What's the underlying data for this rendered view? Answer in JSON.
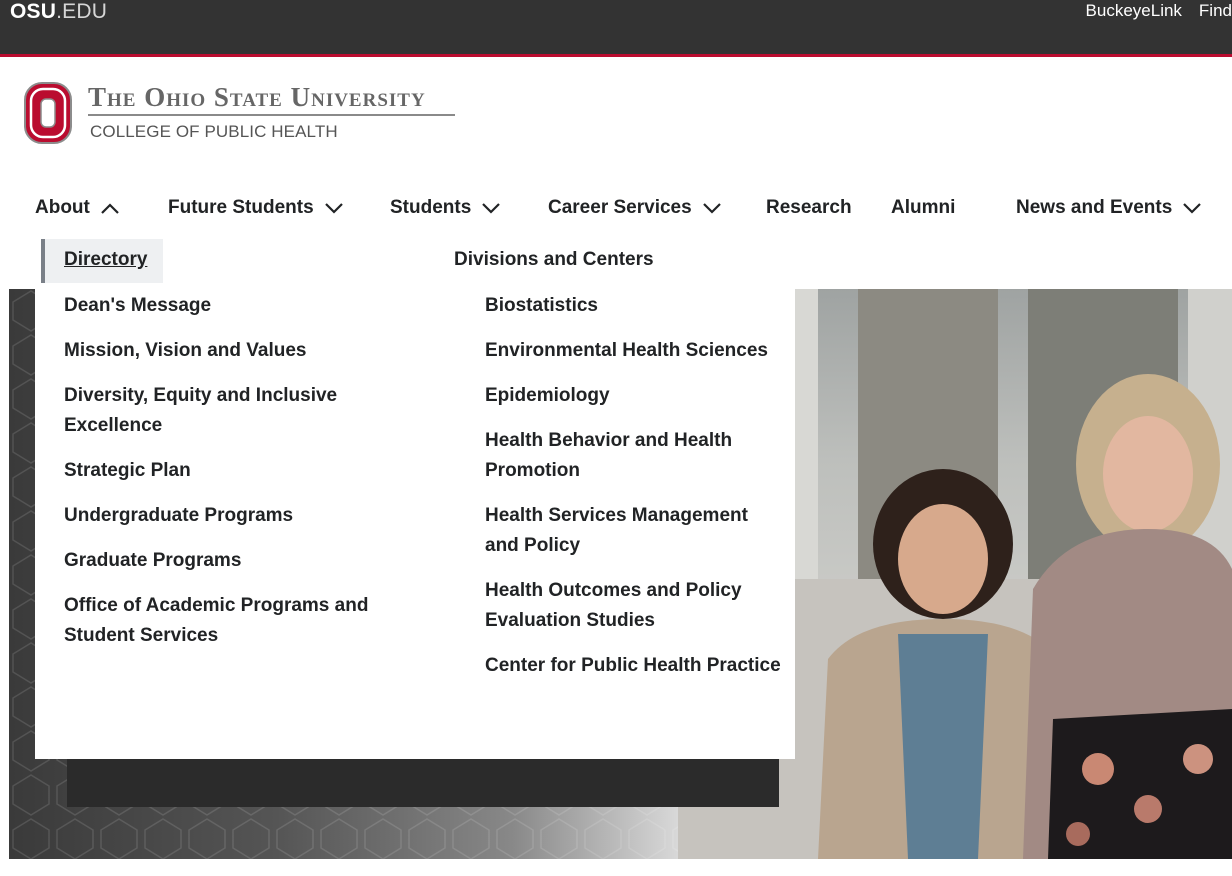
{
  "osu_bar": {
    "logo_bold": "OSU",
    "logo_light": ".EDU",
    "links": [
      "BuckeyeLink",
      "Find"
    ]
  },
  "brand": {
    "university": "The Ohio State University",
    "college": "COLLEGE OF PUBLIC HEALTH"
  },
  "nav": {
    "items": [
      {
        "label": "About",
        "chevron": "up"
      },
      {
        "label": "Future Students",
        "chevron": "down"
      },
      {
        "label": "Students",
        "chevron": "down"
      },
      {
        "label": "Career Services",
        "chevron": "down"
      },
      {
        "label": "Research",
        "chevron": "none"
      },
      {
        "label": "Alumni",
        "chevron": "none"
      },
      {
        "label": "News and Events",
        "chevron": "down"
      }
    ]
  },
  "dropdown": {
    "directory": "Directory",
    "left_items": [
      "Dean's Message",
      "Mission, Vision and Values",
      "Diversity, Equity and Inclusive Excellence",
      "Strategic Plan",
      "Undergraduate Programs",
      "Graduate Programs",
      "Office of Academic Programs and Student Services"
    ],
    "right_heading": "Divisions and Centers",
    "right_items": [
      "Biostatistics",
      "Environmental Health Sciences",
      "Epidemiology",
      "Health Behavior and Health Promotion",
      "Health Services Management and Policy",
      "Health Outcomes and Policy Evaluation Studies",
      "Center for Public Health Practice"
    ]
  },
  "colors": {
    "scarlet": "#ba0c2f",
    "osu_bar": "#333333",
    "text": "#212325"
  }
}
